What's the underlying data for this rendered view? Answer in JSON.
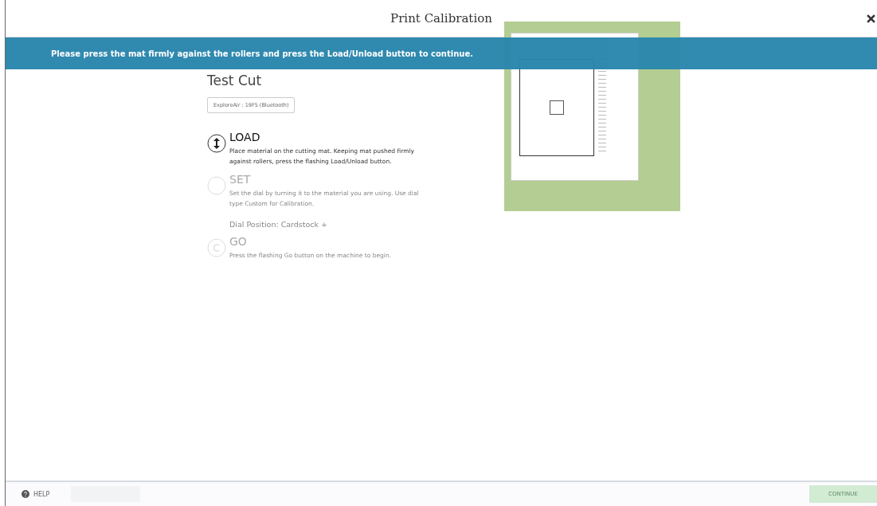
{
  "window": {
    "title": "Print Calibration"
  },
  "banner": {
    "message": "Please press the mat firmly against the rollers and press the Load/Unload button to continue."
  },
  "heading": "Test Cut",
  "device_select": {
    "value": "ExploreAir : 19F5 (Bluetooth)"
  },
  "steps": [
    {
      "kind": "load",
      "title": "LOAD",
      "description": "Place material on the cutting mat. Keeping mat pushed firmly against rollers, press the flashing Load/Unload button.",
      "active": true
    },
    {
      "kind": "set",
      "title": "SET",
      "description": "Set the dial by turning it to the material you are using. Use dial type Custom for Calibration.",
      "active": false,
      "dial": "Dial Position: Cardstock +"
    },
    {
      "kind": "go",
      "title": "GO",
      "description": "Press the flashing Go button on the machine to begin.",
      "active": false
    }
  ],
  "footer": {
    "help": "HELP",
    "continue": {
      "label": "CONTINUE",
      "disabled": true
    }
  }
}
